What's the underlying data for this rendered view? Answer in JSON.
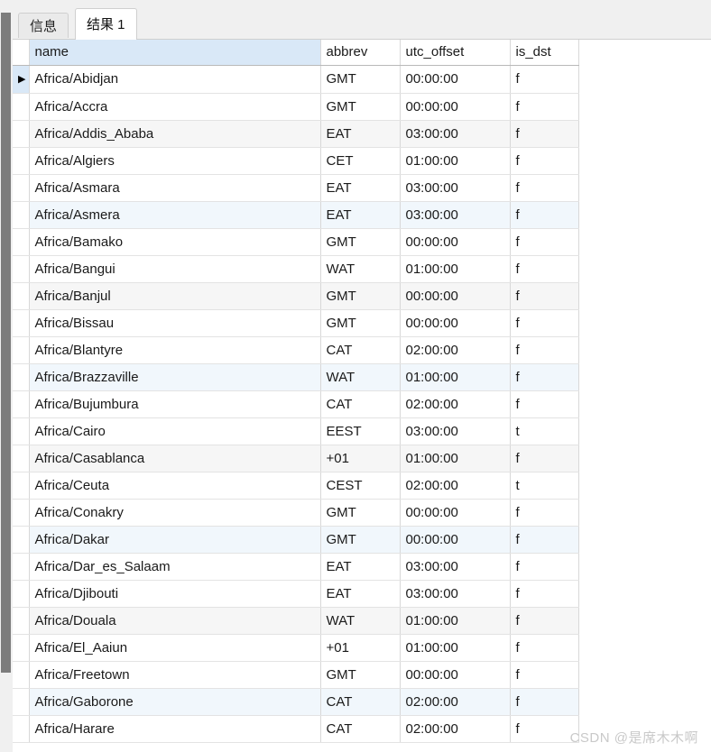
{
  "window": {
    "title": "结果 1"
  },
  "tabs": [
    {
      "label": "信息",
      "active": false,
      "name": "tab-info"
    },
    {
      "label": "结果 1",
      "active": true,
      "name": "tab-result-1"
    }
  ],
  "grid": {
    "gutter_indicator": "▶",
    "selected_column": "name",
    "columns": [
      {
        "key": "name",
        "label": "name"
      },
      {
        "key": "abbrev",
        "label": "abbrev"
      },
      {
        "key": "utc_offset",
        "label": "utc_offset"
      },
      {
        "key": "is_dst",
        "label": "is_dst"
      }
    ],
    "rows": [
      {
        "name": "Africa/Abidjan",
        "abbrev": "GMT",
        "utc_offset": "00:00:00",
        "is_dst": "f",
        "current": true
      },
      {
        "name": "Africa/Accra",
        "abbrev": "GMT",
        "utc_offset": "00:00:00",
        "is_dst": "f"
      },
      {
        "name": "Africa/Addis_Ababa",
        "abbrev": "EAT",
        "utc_offset": "03:00:00",
        "is_dst": "f"
      },
      {
        "name": "Africa/Algiers",
        "abbrev": "CET",
        "utc_offset": "01:00:00",
        "is_dst": "f"
      },
      {
        "name": "Africa/Asmara",
        "abbrev": "EAT",
        "utc_offset": "03:00:00",
        "is_dst": "f"
      },
      {
        "name": "Africa/Asmera",
        "abbrev": "EAT",
        "utc_offset": "03:00:00",
        "is_dst": "f"
      },
      {
        "name": "Africa/Bamako",
        "abbrev": "GMT",
        "utc_offset": "00:00:00",
        "is_dst": "f"
      },
      {
        "name": "Africa/Bangui",
        "abbrev": "WAT",
        "utc_offset": "01:00:00",
        "is_dst": "f"
      },
      {
        "name": "Africa/Banjul",
        "abbrev": "GMT",
        "utc_offset": "00:00:00",
        "is_dst": "f"
      },
      {
        "name": "Africa/Bissau",
        "abbrev": "GMT",
        "utc_offset": "00:00:00",
        "is_dst": "f"
      },
      {
        "name": "Africa/Blantyre",
        "abbrev": "CAT",
        "utc_offset": "02:00:00",
        "is_dst": "f"
      },
      {
        "name": "Africa/Brazzaville",
        "abbrev": "WAT",
        "utc_offset": "01:00:00",
        "is_dst": "f"
      },
      {
        "name": "Africa/Bujumbura",
        "abbrev": "CAT",
        "utc_offset": "02:00:00",
        "is_dst": "f"
      },
      {
        "name": "Africa/Cairo",
        "abbrev": "EEST",
        "utc_offset": "03:00:00",
        "is_dst": "t"
      },
      {
        "name": "Africa/Casablanca",
        "abbrev": "+01",
        "utc_offset": "01:00:00",
        "is_dst": "f"
      },
      {
        "name": "Africa/Ceuta",
        "abbrev": "CEST",
        "utc_offset": "02:00:00",
        "is_dst": "t"
      },
      {
        "name": "Africa/Conakry",
        "abbrev": "GMT",
        "utc_offset": "00:00:00",
        "is_dst": "f"
      },
      {
        "name": "Africa/Dakar",
        "abbrev": "GMT",
        "utc_offset": "00:00:00",
        "is_dst": "f"
      },
      {
        "name": "Africa/Dar_es_Salaam",
        "abbrev": "EAT",
        "utc_offset": "03:00:00",
        "is_dst": "f"
      },
      {
        "name": "Africa/Djibouti",
        "abbrev": "EAT",
        "utc_offset": "03:00:00",
        "is_dst": "f"
      },
      {
        "name": "Africa/Douala",
        "abbrev": "WAT",
        "utc_offset": "01:00:00",
        "is_dst": "f"
      },
      {
        "name": "Africa/El_Aaiun",
        "abbrev": "+01",
        "utc_offset": "01:00:00",
        "is_dst": "f"
      },
      {
        "name": "Africa/Freetown",
        "abbrev": "GMT",
        "utc_offset": "00:00:00",
        "is_dst": "f"
      },
      {
        "name": "Africa/Gaborone",
        "abbrev": "CAT",
        "utc_offset": "02:00:00",
        "is_dst": "f"
      },
      {
        "name": "Africa/Harare",
        "abbrev": "CAT",
        "utc_offset": "02:00:00",
        "is_dst": "f"
      }
    ]
  },
  "watermark": {
    "text": "CSDN @是席木木啊"
  },
  "colors": {
    "selection_blue": "#d9e8f7",
    "band_blue": "#f1f7fc",
    "band_gray": "#f6f6f6",
    "scrollbar_thumb": "#7c7c7c",
    "chrome": "#f0f0f0",
    "grid_line": "#e3e3e3"
  }
}
